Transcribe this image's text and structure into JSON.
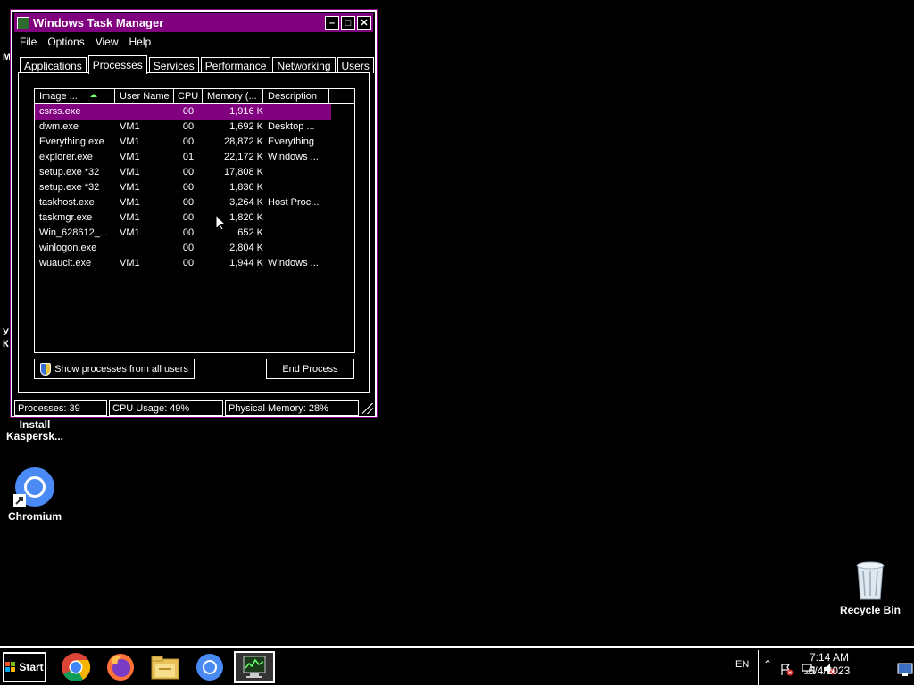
{
  "desktop": {
    "icons": [
      {
        "label_line1": "Install",
        "label_line2": "Kaspersk..."
      },
      {
        "label_line1": "Chromium",
        "label_line2": ""
      },
      {
        "label_line1": "Recycle Bin",
        "label_line2": ""
      }
    ],
    "edge_fragments": [
      "M",
      "У",
      "К"
    ]
  },
  "window": {
    "title": "Windows Task Manager",
    "controls": {
      "minimize": "–",
      "maximize": "□",
      "close": "✕"
    },
    "menu": [
      "File",
      "Options",
      "View",
      "Help"
    ],
    "tabs": [
      {
        "label": "Applications",
        "active": false
      },
      {
        "label": "Processes",
        "active": true
      },
      {
        "label": "Services",
        "active": false
      },
      {
        "label": "Performance",
        "active": false
      },
      {
        "label": "Networking",
        "active": false
      },
      {
        "label": "Users",
        "active": false
      }
    ],
    "columns": [
      "Image ...",
      "User Name",
      "CPU",
      "Memory (...",
      "Description"
    ],
    "processes": [
      {
        "image": "csrss.exe",
        "user": "",
        "cpu": "00",
        "memory": "1,916 K",
        "description": "",
        "selected": true
      },
      {
        "image": "dwm.exe",
        "user": "VM1",
        "cpu": "00",
        "memory": "1,692 K",
        "description": "Desktop ..."
      },
      {
        "image": "Everything.exe",
        "user": "VM1",
        "cpu": "00",
        "memory": "28,872 K",
        "description": "Everything"
      },
      {
        "image": "explorer.exe",
        "user": "VM1",
        "cpu": "01",
        "memory": "22,172 K",
        "description": "Windows ..."
      },
      {
        "image": "setup.exe *32",
        "user": "VM1",
        "cpu": "00",
        "memory": "17,808 K",
        "description": ""
      },
      {
        "image": "setup.exe *32",
        "user": "VM1",
        "cpu": "00",
        "memory": "1,836 K",
        "description": ""
      },
      {
        "image": "taskhost.exe",
        "user": "VM1",
        "cpu": "00",
        "memory": "3,264 K",
        "description": "Host Proc..."
      },
      {
        "image": "taskmgr.exe",
        "user": "VM1",
        "cpu": "00",
        "memory": "1,820 K",
        "description": ""
      },
      {
        "image": "Win_628612_...",
        "user": "VM1",
        "cpu": "00",
        "memory": "652 K",
        "description": ""
      },
      {
        "image": "winlogon.exe",
        "user": "",
        "cpu": "00",
        "memory": "2,804 K",
        "description": ""
      },
      {
        "image": "wuauclt.exe",
        "user": "VM1",
        "cpu": "00",
        "memory": "1,944 K",
        "description": "Windows ..."
      }
    ],
    "show_all_label": "Show processes from all users",
    "end_process_label": "End Process",
    "status": {
      "processes": "Processes: 39",
      "cpu": "CPU Usage: 49%",
      "memory": "Physical Memory: 28%"
    }
  },
  "taskbar": {
    "start_label": "Start",
    "apps": [
      "chrome-icon",
      "firefox-icon",
      "file-explorer-icon",
      "chromium-icon",
      "task-manager-icon"
    ],
    "tray": {
      "language": "EN",
      "time": "7:14 AM",
      "date": "6/4/2023"
    }
  }
}
